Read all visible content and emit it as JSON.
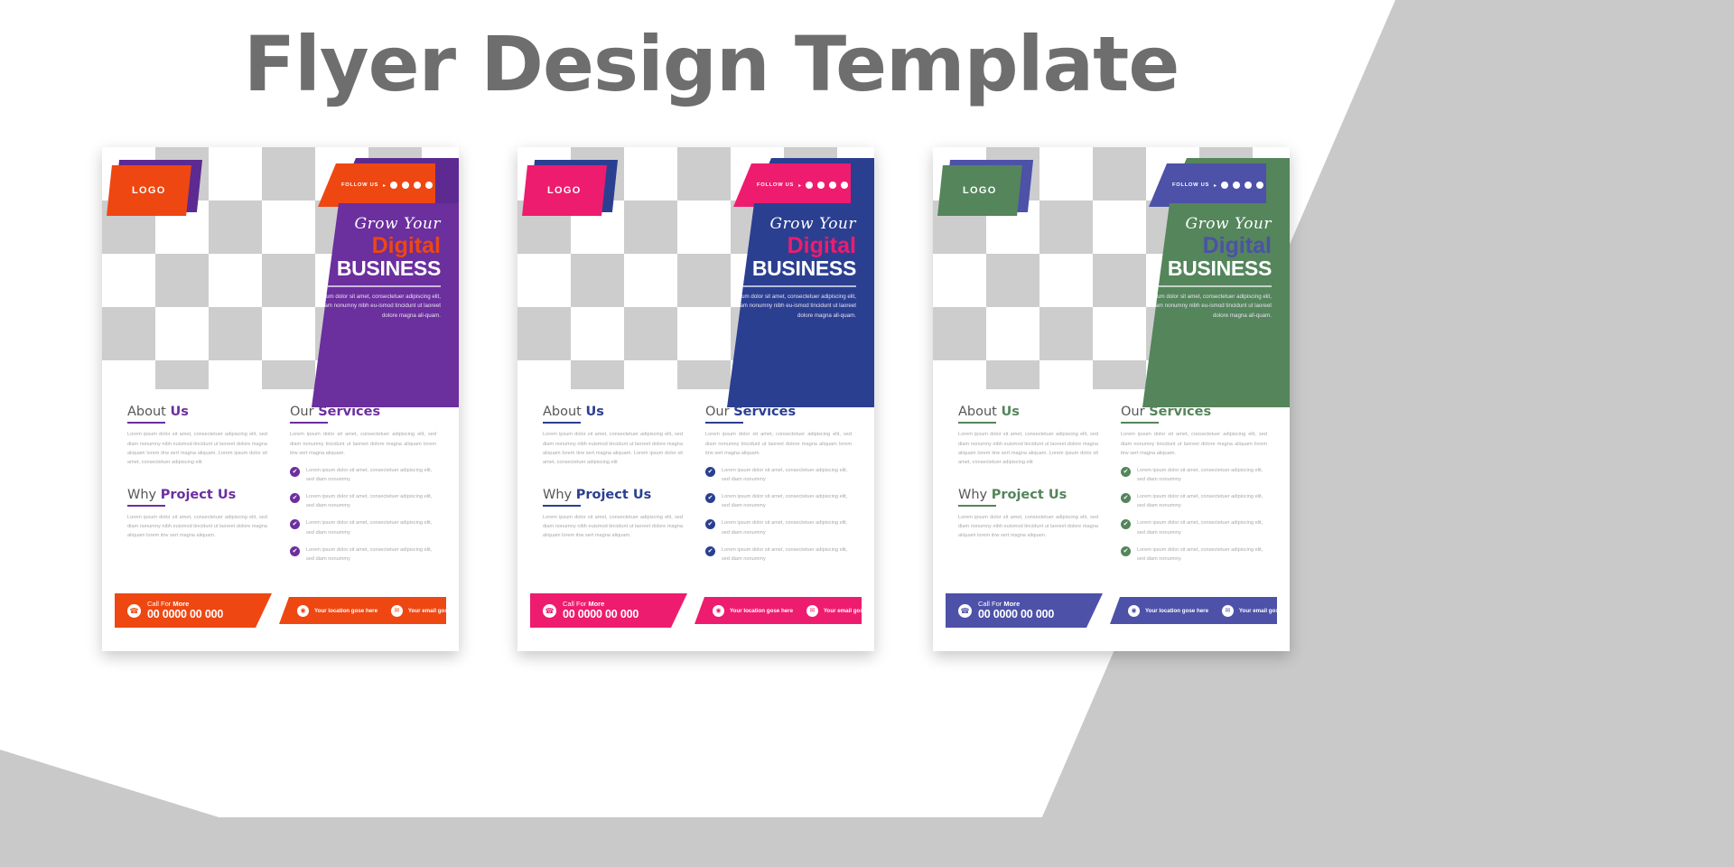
{
  "page": {
    "title": "Flyer Design Template",
    "background_color": "#c9c9c9",
    "canvas_color": "#ffffff"
  },
  "shared": {
    "logo_label": "LOGO",
    "follow_label": "FOLLOW US",
    "follow_arrow": "▸",
    "follow_dots": 4,
    "hero": {
      "line1": "Grow Your",
      "line2": "Digital",
      "line3": "BUSINESS",
      "description": "Lorem ipsum dolor sit amet, consectetuer adipiscing elit, sed diam nonumny nibh eu-ismod tincidunt ut laoreet dolore magna all-quam."
    },
    "about": {
      "title_light": "About ",
      "title_bold": "Us",
      "paragraph": "Lorem ipsum dolor sit amet, consectetuer adipiscing elit, sed diam nonumny nibh euismod tincidunt ut laoreet dolore magna aliquam lorem itrw sert magna aliquam.  Lorem ipsum dolor sit amet, consectetuer adipiscing elit"
    },
    "why": {
      "title_light": "Why ",
      "title_bold": "Project Us",
      "paragraph": "Lorem ipsum dolor sit amet, consectetuer adipiscing elit, sed diam nonumny nibh euismod tincidunt ut laoreet dolore magna aliquam lorem itrw sert magna aliquam."
    },
    "services": {
      "title_light": "Our ",
      "title_bold": "Services",
      "paragraph": "Lorem ipsum dolor sit amet, consectetuer adipiscing elit, sed diam nonumny tincidunt ut laoreet dolore magna aliquam lorem itrw sert magna aliquam.",
      "items": [
        "Lorem ipsum dolor sit amet, consectetuer adipiscing elit, sed diam nonummy",
        "Lorem ipsum dolor sit amet, consectetuer adipiscing elit, sed diam nonummy",
        "Lorem ipsum dolor sit amet, consectetuer adipiscing elit, sed diam nonummy",
        "Lorem ipsum dolor sit amet, consectetuer adipiscing elit, sed diam nonummy"
      ],
      "check_glyph": "✔"
    },
    "footer": {
      "call_light": "Call For ",
      "call_bold": "More",
      "phone": "00 0000 00 000",
      "location": "Your location gose here",
      "email": "Your email gose here",
      "phone_glyph": "☎",
      "pin_glyph": "◉",
      "mail_glyph": "✉"
    }
  },
  "flyers": [
    {
      "id": "flyer-1",
      "name": "orange-purple",
      "logo_bg": "#ee4712",
      "logo_shadow": "#5c2a91",
      "follow_bg": "#ee4712",
      "follow_shadow": "#5c2a91",
      "hero_bg": "#6b2f9e",
      "hero_accent": "#ee4712",
      "accent": "#6b2f9e",
      "rule": "#6b2f9e",
      "bullet_bg": "#6b2f9e",
      "footer_left_bg": "#ee4712",
      "footer_right_bg": "#ee4712",
      "footer_icon_color": "#ee4712"
    },
    {
      "id": "flyer-2",
      "name": "pink-blue",
      "logo_bg": "#ee1c6e",
      "logo_shadow": "#2b3f91",
      "follow_bg": "#ee1c6e",
      "follow_shadow": "#2b3f91",
      "hero_bg": "#2b3f91",
      "hero_accent": "#ee1c6e",
      "accent": "#2b3f91",
      "rule": "#2b3f91",
      "bullet_bg": "#2b3f91",
      "footer_left_bg": "#ee1c6e",
      "footer_right_bg": "#ee1c6e",
      "footer_icon_color": "#ee1c6e"
    },
    {
      "id": "flyer-3",
      "name": "green-blue",
      "logo_bg": "#54855b",
      "logo_shadow": "#4d51a8",
      "follow_bg": "#4d51a8",
      "follow_shadow": "#54855b",
      "hero_bg": "#54855b",
      "hero_accent": "#4d51a8",
      "accent": "#54855b",
      "rule": "#54855b",
      "bullet_bg": "#54855b",
      "footer_left_bg": "#4d51a8",
      "footer_right_bg": "#4d51a8",
      "footer_icon_color": "#4d51a8"
    }
  ]
}
